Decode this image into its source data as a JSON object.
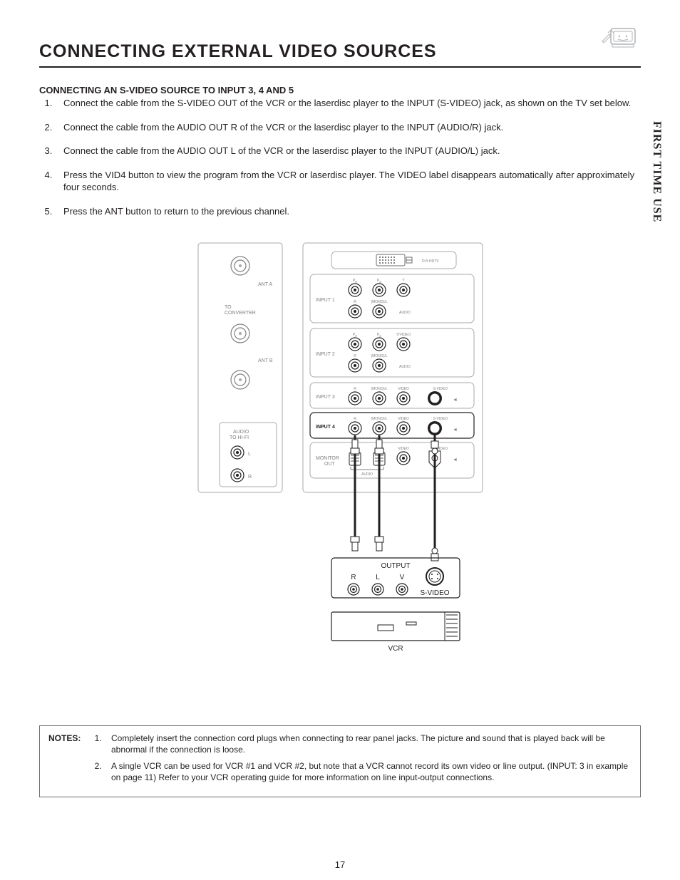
{
  "title": "CONNECTING EXTERNAL VIDEO SOURCES",
  "side_tab": "FIRST TIME USE",
  "page_number": "17",
  "subheading": "CONNECTING AN S-VIDEO SOURCE TO INPUT 3, 4 AND 5",
  "steps": [
    "Connect the cable from the S-VIDEO OUT of the VCR or the laserdisc player to the INPUT (S-VIDEO) jack, as shown on the TV set below.",
    "Connect the cable from the AUDIO OUT R of the VCR or the laserdisc player to the INPUT (AUDIO/R) jack.",
    "Connect the cable from the AUDIO OUT L of the VCR or the laserdisc player to the INPUT (AUDIO/L) jack.",
    "Press the VID4 button to view the program from the VCR or laserdisc player.  The VIDEO label disappears automatically after approximately four seconds.",
    "Press the ANT button to return to the previous channel."
  ],
  "notes_label": "NOTES:",
  "notes": [
    "Completely insert the connection cord plugs when connecting to rear panel jacks.  The picture and sound that is played back will be abnormal if the connection is loose.",
    "A single VCR can be used for VCR #1 and VCR #2, but note that a VCR cannot record its own video or line output.  (INPUT: 3 in example on page 11)  Refer to your VCR operating guide for more information on line input-output connections."
  ],
  "diagram": {
    "ant_a": "ANT A",
    "to_converter": "TO\nCONVERTER",
    "ant_b": "ANT B",
    "audio_to_hifi": "AUDIO\nTO HI-FI",
    "l": "L",
    "r": "R",
    "dvi": "DVI-HDTV",
    "input1": "INPUT 1",
    "input2": "INPUT 2",
    "input3": "INPUT 3",
    "input4": "INPUT 4",
    "monitor_out": "MONITOR\nOUT",
    "pr": "PR",
    "pb": "PB",
    "y": "Y",
    "yvideo": "Y/VIDEO",
    "mono_l": "(MONO)/L",
    "audio": "AUDIO",
    "video": "VIDEO",
    "svideo": "S-VIDEO",
    "output": "OUTPUT",
    "v": "V",
    "vcr": "VCR",
    "arrow": "◄"
  }
}
